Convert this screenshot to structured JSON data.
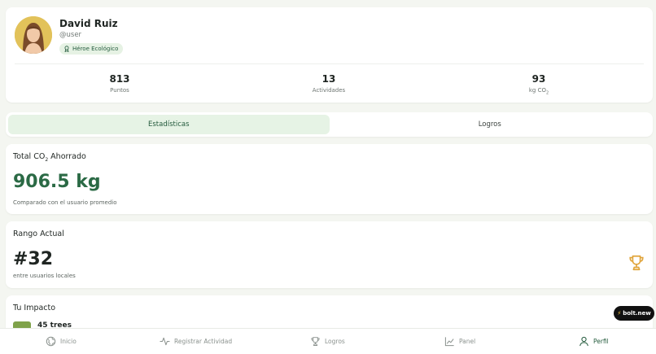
{
  "profile": {
    "name": "David Ruiz",
    "handle": "@user",
    "badge": "Héroe Ecológico",
    "stats": [
      {
        "value": "813",
        "label": "Puntos"
      },
      {
        "value": "13",
        "label": "Actividades"
      },
      {
        "value": "93",
        "label": "kg CO",
        "sub": "2"
      }
    ]
  },
  "tabs": [
    {
      "label": "Estadísticas",
      "active": true
    },
    {
      "label": "Logros",
      "active": false
    }
  ],
  "co2": {
    "title": "Total CO",
    "title_sub": "2",
    "title_rest": " Ahorrado",
    "value": "906.5 kg",
    "note": "Comparado con el usuario promedio"
  },
  "rank": {
    "title": "Rango Actual",
    "value": "#32",
    "note": "entre usuarios locales"
  },
  "impact": {
    "title": "Tu Impacto",
    "item": "45 trees"
  },
  "bolt": {
    "label": "bolt.new"
  },
  "nav": [
    {
      "label": "Inicio",
      "icon": "globe-icon"
    },
    {
      "label": "Registrar Actividad",
      "icon": "activity-icon"
    },
    {
      "label": "Logros",
      "icon": "trophy-icon"
    },
    {
      "label": "Panel",
      "icon": "chart-icon"
    },
    {
      "label": "Perfil",
      "icon": "user-icon",
      "active": true
    }
  ],
  "colors": {
    "accent_green": "#2b6a45",
    "tab_active_bg": "#e6f3e5",
    "trophy": "#e0a43a",
    "background": "#f4f6f1"
  }
}
